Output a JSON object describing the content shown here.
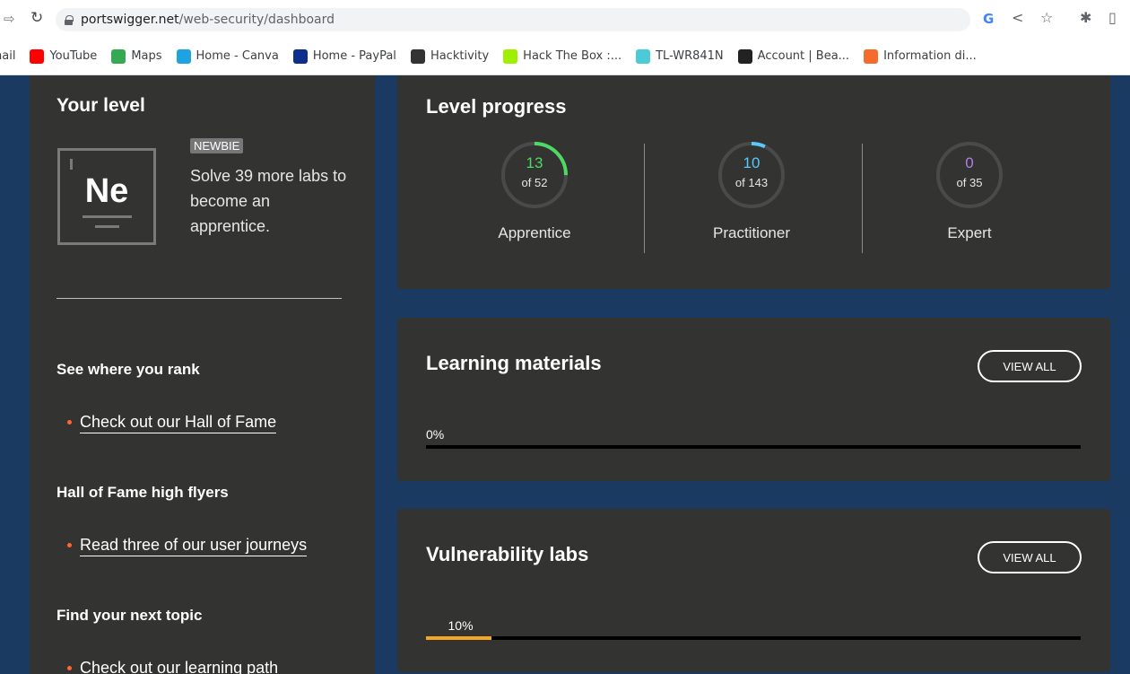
{
  "browser": {
    "url_host": "portswigger.net",
    "url_path": "/web-security/dashboard",
    "bookmarks": [
      {
        "label": "nail",
        "icon": "gmail-icon",
        "color": "#ffffff"
      },
      {
        "label": "YouTube",
        "icon": "youtube-icon",
        "color": "#ff0000"
      },
      {
        "label": "Maps",
        "icon": "maps-icon",
        "color": "#34a853"
      },
      {
        "label": "Home - Canva",
        "icon": "canva-icon",
        "color": "#1fa3e0"
      },
      {
        "label": "Home - PayPal",
        "icon": "paypal-icon",
        "color": "#0d2f8c"
      },
      {
        "label": "Hacktivity",
        "icon": "hackerone-icon",
        "color": "#333333"
      },
      {
        "label": "Hack The Box :...",
        "icon": "htb-icon",
        "color": "#9fef00"
      },
      {
        "label": "TL-WR841N",
        "icon": "tplink-icon",
        "color": "#4acbd6"
      },
      {
        "label": "Account | Bea...",
        "icon": "account-icon",
        "color": "#222222"
      },
      {
        "label": "Information di...",
        "icon": "info-icon",
        "color": "#f46b2c"
      }
    ]
  },
  "level": {
    "title": "Your level",
    "symbol": "Ne",
    "badge": "NEWBIE",
    "text": "Solve 39 more labs to become an apprentice."
  },
  "sidebar": {
    "sections": [
      {
        "heading": "See where you rank",
        "link": "Check out our Hall of Fame"
      },
      {
        "heading": "Hall of Fame high flyers",
        "link": "Read three of our user journeys"
      },
      {
        "heading": "Find your next topic",
        "link": "Check out our learning path"
      }
    ]
  },
  "progress": {
    "title": "Level progress",
    "levels": [
      {
        "name": "Apprentice",
        "solved": "13",
        "total_text": "of 52",
        "fraction": 0.25,
        "color": "#4cd964"
      },
      {
        "name": "Practitioner",
        "solved": "10",
        "total_text": "of 143",
        "fraction": 0.07,
        "color": "#5ac8fa"
      },
      {
        "name": "Expert",
        "solved": "0",
        "total_text": "of 35",
        "fraction": 0,
        "color": "#b27ee8"
      }
    ]
  },
  "materials": {
    "title": "Learning materials",
    "button": "VIEW ALL",
    "percent_text": "0%",
    "fraction": 0
  },
  "labs": {
    "title": "Vulnerability labs",
    "button": "VIEW ALL",
    "percent_text": "10%",
    "fraction": 0.1
  }
}
